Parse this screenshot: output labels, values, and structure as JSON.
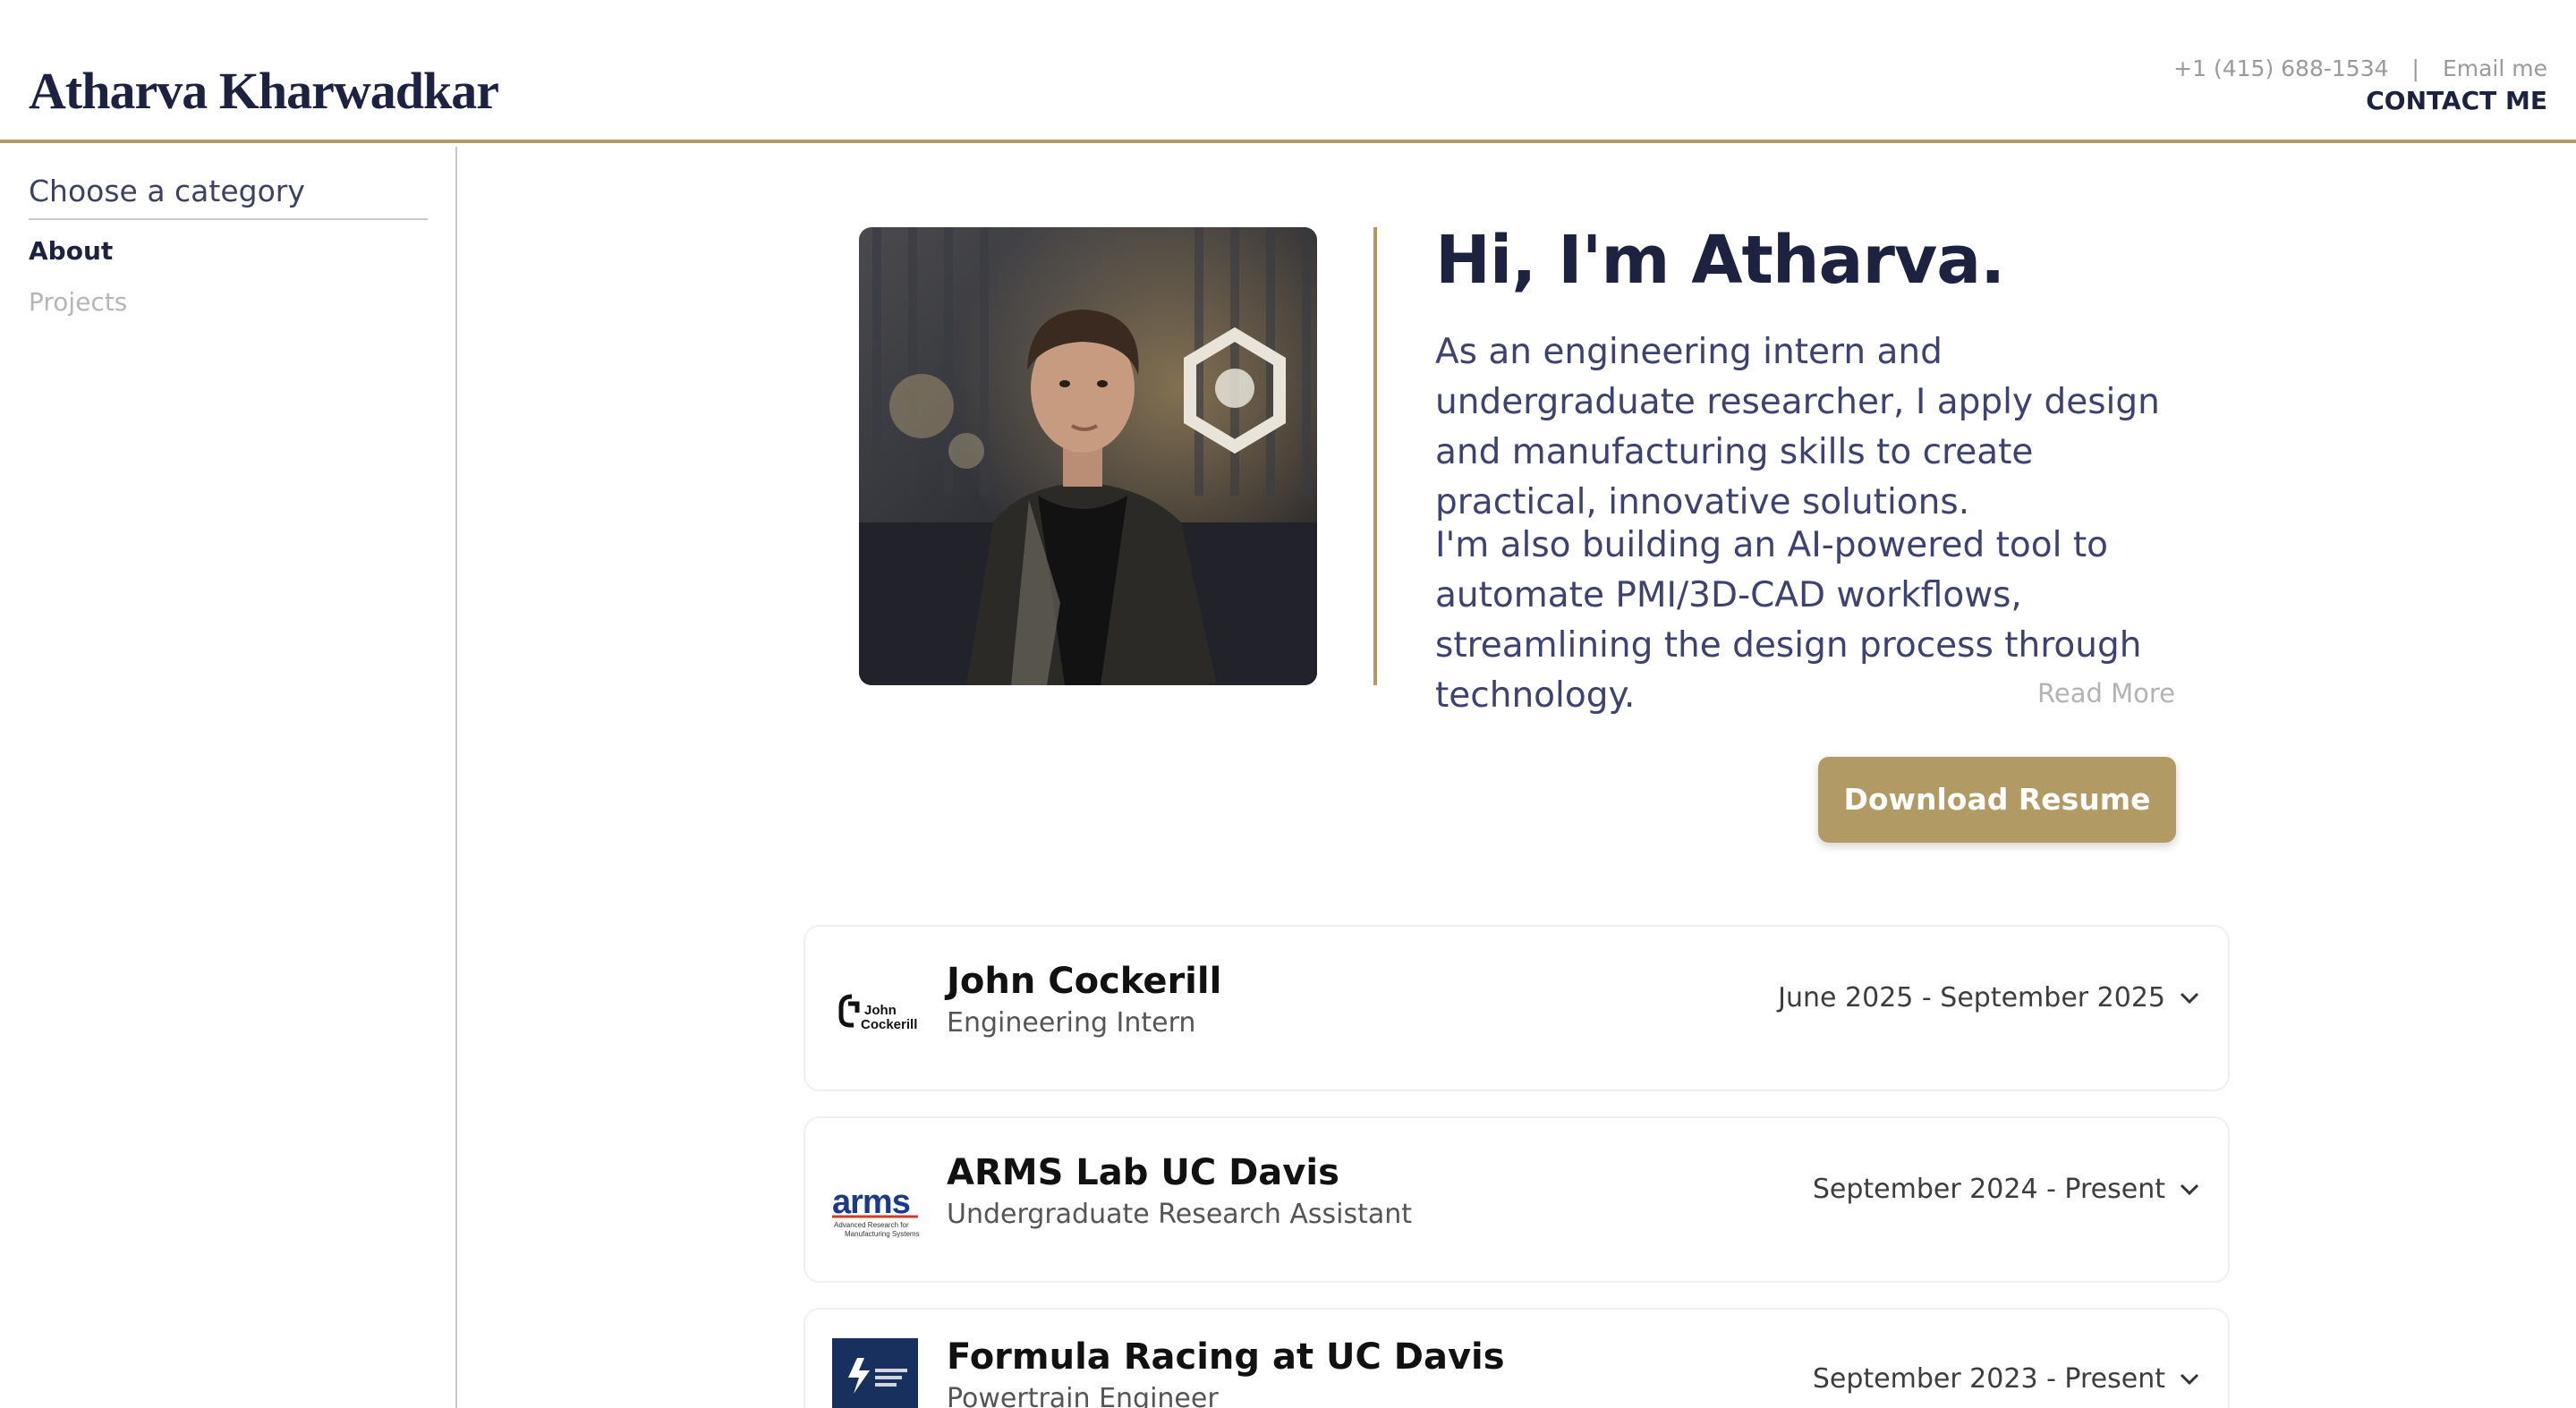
{
  "header": {
    "name": "Atharva Kharwadkar",
    "phone": "+1 (415) 688-1534",
    "separator": "|",
    "email_link": "Email me",
    "contact_label": "CONTACT ME"
  },
  "sidebar": {
    "title": "Choose a category",
    "items": [
      {
        "label": "About",
        "active": true
      },
      {
        "label": "Projects",
        "active": false
      }
    ]
  },
  "hero": {
    "greeting": "Hi, I'm Atharva.",
    "paragraph1": "As an engineering intern and undergraduate researcher, I apply design and manufacturing skills to create practical, innovative solutions.",
    "paragraph2": "I'm also building an AI-powered tool to automate PMI/3D-CAD workflows, streamlining the design process through technology.",
    "read_more": "Read More",
    "download_label": "Download Resume"
  },
  "experience": [
    {
      "company": "John Cockerill",
      "role": "Engineering Intern",
      "dates": "June 2025 - September 2025",
      "logo": "john-cockerill-logo",
      "logo_text": [
        "John",
        "Cockerill"
      ]
    },
    {
      "company": "ARMS Lab UC Davis",
      "role": "Undergraduate Research Assistant",
      "dates": "September 2024 - Present",
      "logo": "arms-lab-logo",
      "logo_text": [
        "arms",
        "Advanced Research for",
        "Manufacturing Systems"
      ]
    },
    {
      "company": "Formula Racing at UC Davis",
      "role": "Powertrain Engineer",
      "dates": "September 2023 - Present",
      "logo": "formula-racing-logo"
    }
  ],
  "colors": {
    "accent": "#b19a63",
    "navy": "#1d2240",
    "muted": "#b3b3b3"
  }
}
